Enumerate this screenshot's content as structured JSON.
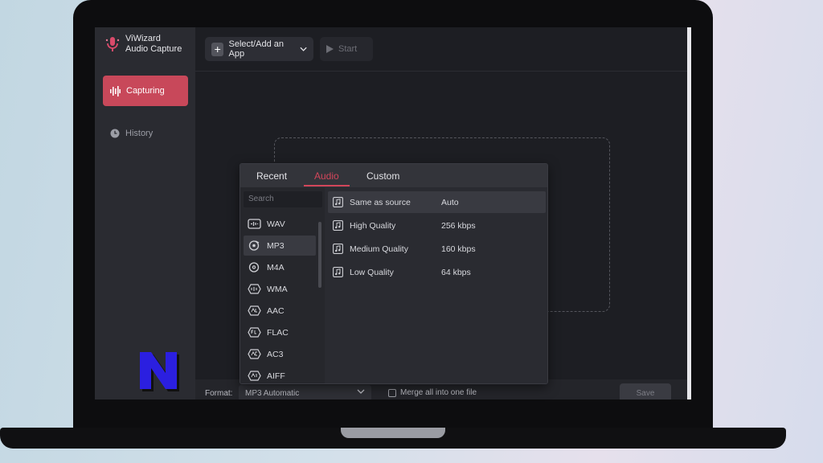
{
  "app": {
    "title_line1": "ViWizard",
    "title_line2": "Audio Capture",
    "accent": "#c8485a"
  },
  "sidebar": {
    "items": [
      {
        "label": "Capturing",
        "icon": "waveform-icon",
        "active": true
      },
      {
        "label": "History",
        "icon": "clock-icon",
        "active": false
      }
    ]
  },
  "toolbar": {
    "add_label": "Select/Add an App",
    "start_label": "Start"
  },
  "format_popup": {
    "tabs": [
      {
        "label": "Recent",
        "active": false
      },
      {
        "label": "Audio",
        "active": true
      },
      {
        "label": "Custom",
        "active": false
      }
    ],
    "search_placeholder": "Search",
    "formats": [
      {
        "label": "WAV",
        "selected": false
      },
      {
        "label": "MP3",
        "selected": true
      },
      {
        "label": "M4A",
        "selected": false
      },
      {
        "label": "WMA",
        "selected": false
      },
      {
        "label": "AAC",
        "selected": false
      },
      {
        "label": "FLAC",
        "selected": false
      },
      {
        "label": "AC3",
        "selected": false
      },
      {
        "label": "AIFF",
        "selected": false
      }
    ],
    "qualities": [
      {
        "name": "Same as source",
        "rate": "Auto",
        "selected": true
      },
      {
        "name": "High Quality",
        "rate": "256 kbps",
        "selected": false
      },
      {
        "name": "Medium Quality",
        "rate": "160 kbps",
        "selected": false
      },
      {
        "name": "Low Quality",
        "rate": "64 kbps",
        "selected": false
      }
    ]
  },
  "bottombar": {
    "format_label": "Format:",
    "format_value": "MP3 Automatic",
    "merge_label": "Merge all into one file",
    "save_label": "Save"
  }
}
